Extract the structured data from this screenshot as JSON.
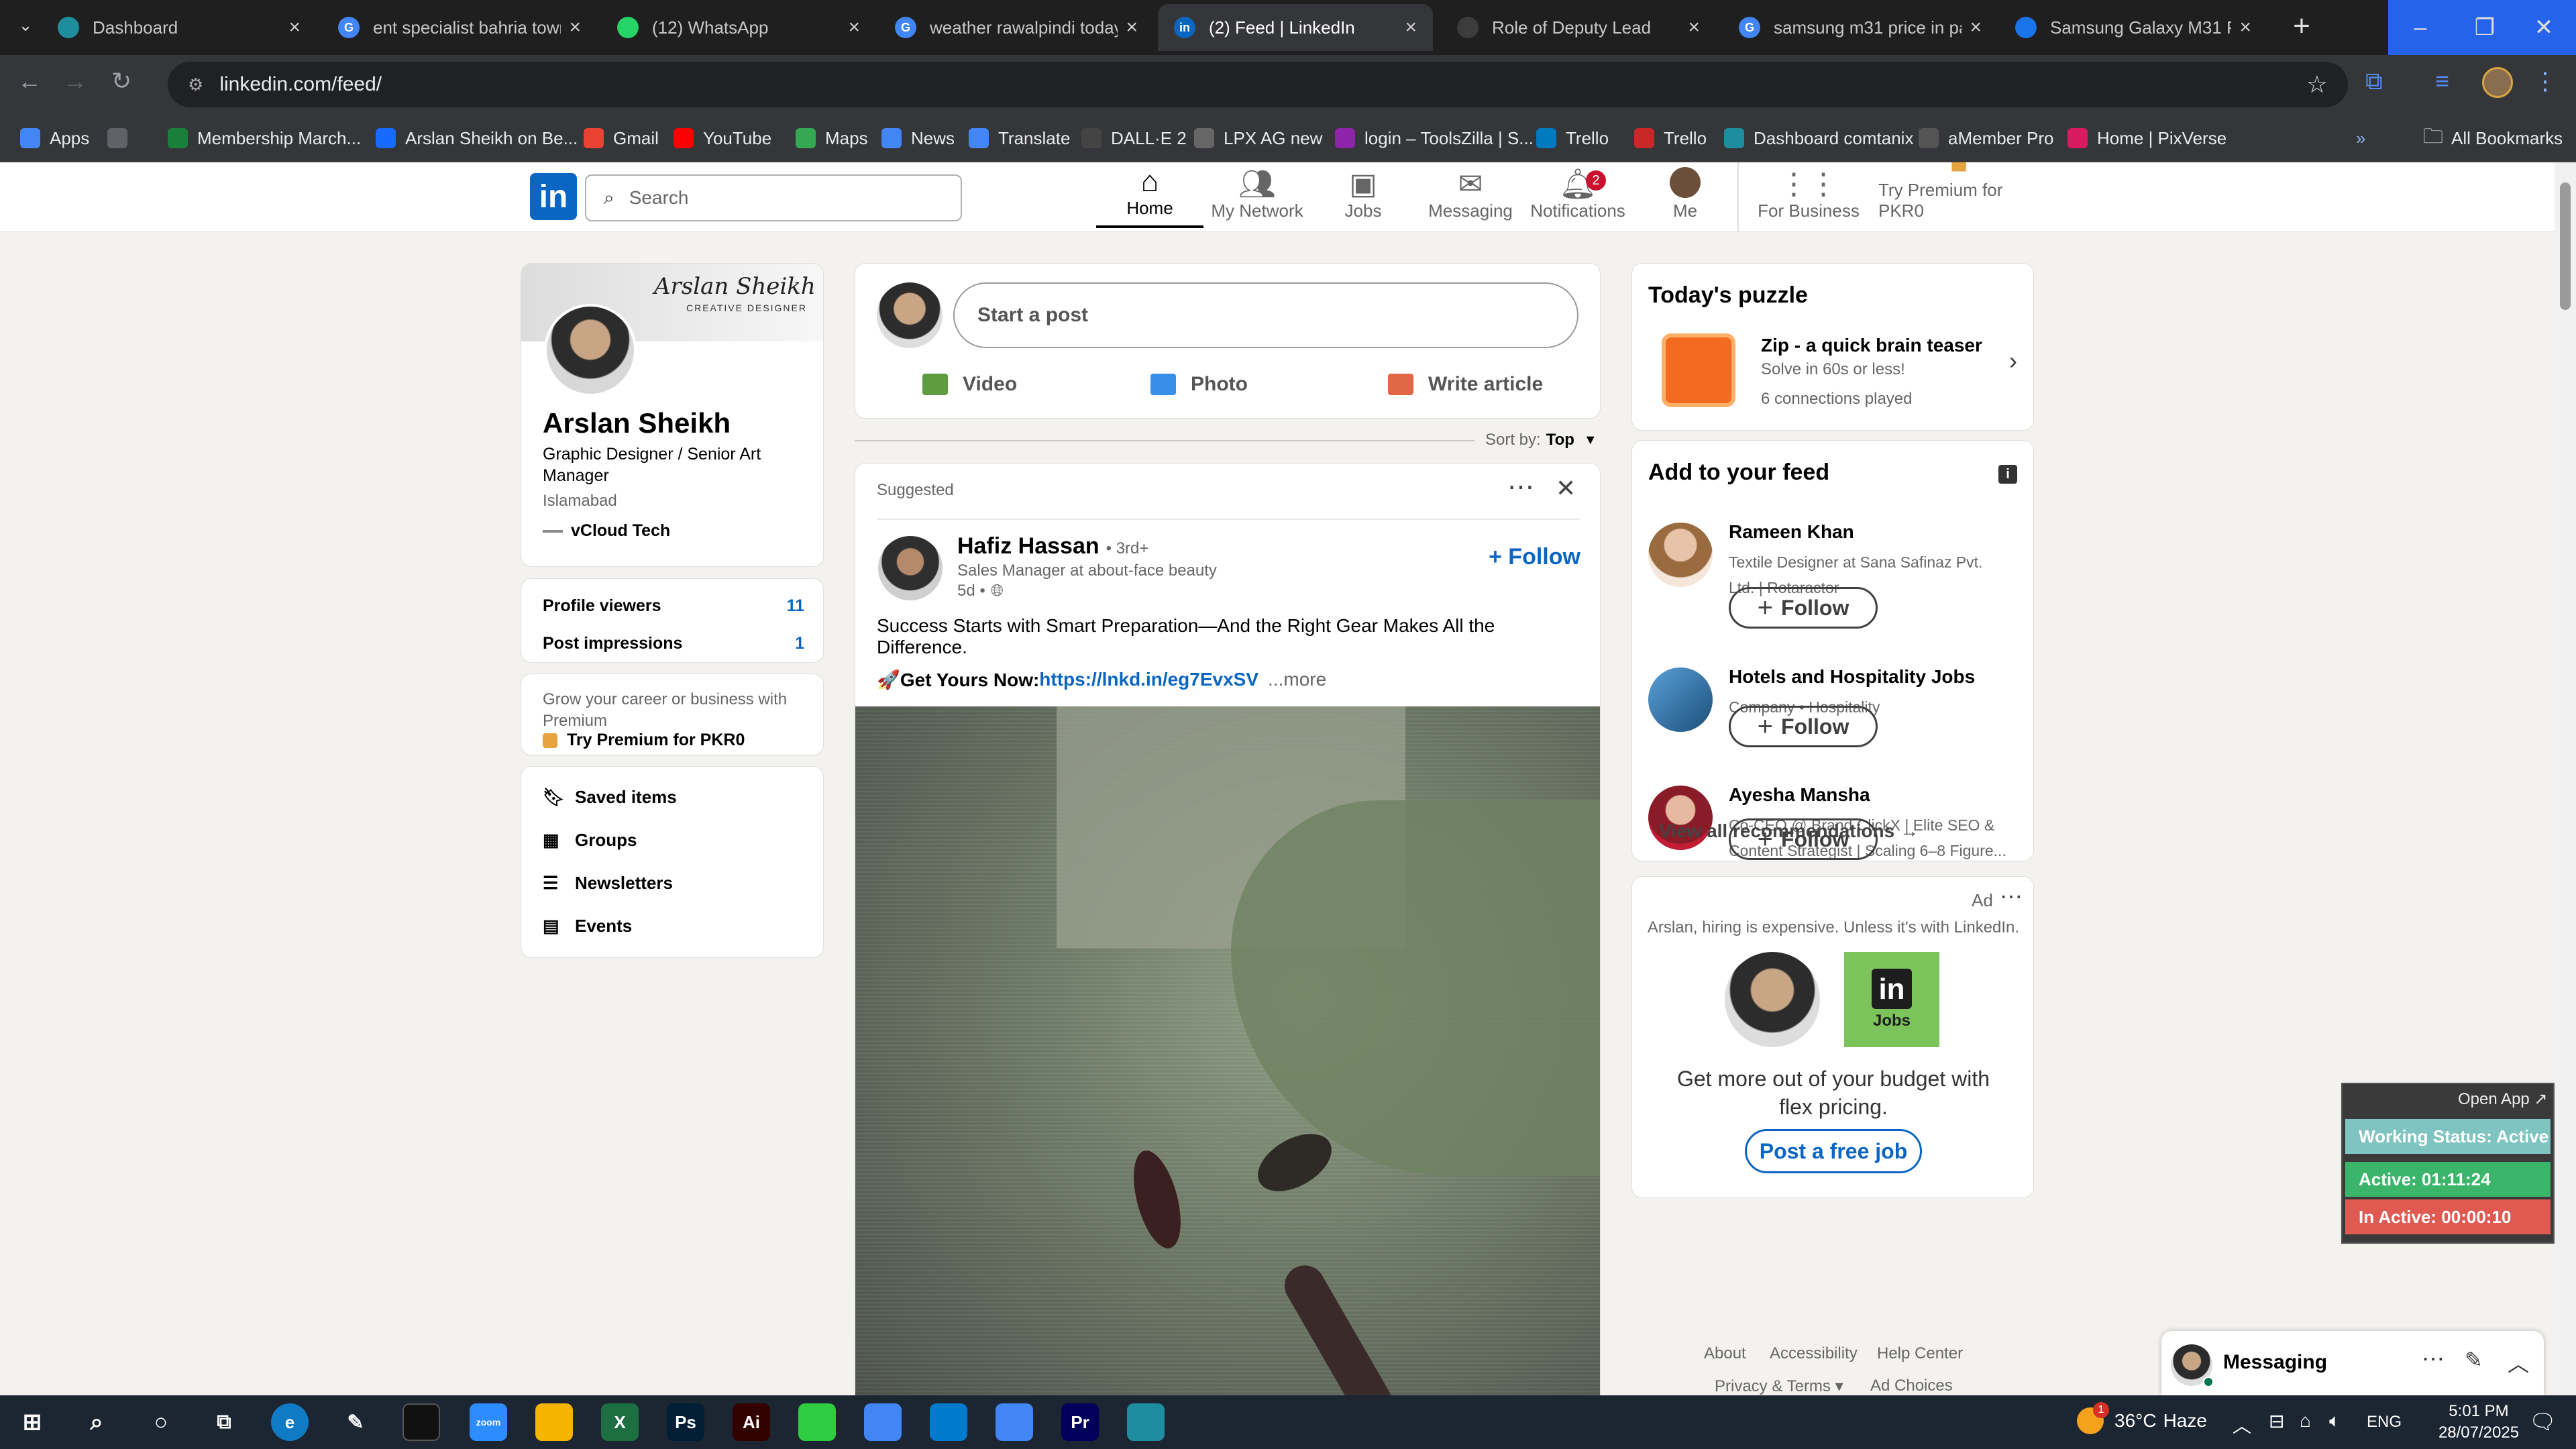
{
  "browser": {
    "tabs": [
      {
        "title": "Dashboard",
        "icon": "tab-favicon-icon",
        "color": "#1e8e9e"
      },
      {
        "title": "ent specialist bahria town",
        "icon": "google-icon",
        "color": "#4285f4"
      },
      {
        "title": "(12) WhatsApp",
        "icon": "whatsapp-icon",
        "color": "#25d366"
      },
      {
        "title": "weather rawalpindi today",
        "icon": "google-icon",
        "color": "#4285f4"
      },
      {
        "title": "(2) Feed | LinkedIn",
        "icon": "linkedin-icon",
        "color": "#0a66c2"
      },
      {
        "title": "Role of Deputy Lead",
        "icon": "tab-favicon-icon",
        "color": "#3c3c3c"
      },
      {
        "title": "samsung m31 price in pa",
        "icon": "google-icon",
        "color": "#4285f4"
      },
      {
        "title": "Samsung Galaxy M31 Pric",
        "icon": "tab-favicon-icon",
        "color": "#1a73e8"
      }
    ],
    "url": "linkedin.com/feed/",
    "bookmarks": [
      {
        "label": "Apps",
        "color": "#4285f4"
      },
      {
        "label": "",
        "color": "#5f6368"
      },
      {
        "label": "Membership March...",
        "color": "#188038"
      },
      {
        "label": "Arslan Sheikh on Be...",
        "color": "#1769ff"
      },
      {
        "label": "Gmail",
        "color": "#ea4335"
      },
      {
        "label": "YouTube",
        "color": "#ff0000"
      },
      {
        "label": "Maps",
        "color": "#34a853"
      },
      {
        "label": "News",
        "color": "#4285f4"
      },
      {
        "label": "Translate",
        "color": "#4285f4"
      },
      {
        "label": "DALL·E 2",
        "color": "#444444"
      },
      {
        "label": "LPX AG new",
        "color": "#666666"
      },
      {
        "label": "login – ToolsZilla | S...",
        "color": "#8e24aa"
      },
      {
        "label": "Trello",
        "color": "#0079bf"
      },
      {
        "label": "Trello",
        "color": "#c62828"
      },
      {
        "label": "Dashboard comtanix",
        "color": "#1e8e9e"
      },
      {
        "label": "aMember Pro",
        "color": "#555555"
      },
      {
        "label": "Home | PixVerse",
        "color": "#d81b60"
      }
    ],
    "all_bookmarks": "All Bookmarks"
  },
  "linkedin": {
    "search_placeholder": "Search",
    "nav": [
      {
        "label": "Home",
        "icon": "home-icon"
      },
      {
        "label": "My Network",
        "icon": "network-icon"
      },
      {
        "label": "Jobs",
        "icon": "briefcase-icon"
      },
      {
        "label": "Messaging",
        "icon": "messaging-icon"
      },
      {
        "label": "Notifications",
        "icon": "bell-icon",
        "badge": "2"
      },
      {
        "label": "Me",
        "icon": "avatar-icon"
      },
      {
        "label": "For Business",
        "icon": "grid-icon"
      },
      {
        "label": "Try Premium for PKR0",
        "icon": "premium-icon"
      }
    ],
    "profile": {
      "banner_name": "Arslan Sheikh",
      "banner_sub": "CREATIVE DESIGNER",
      "name": "Arslan Sheikh",
      "headline": "Graphic Designer / Senior Art Manager",
      "location": "Islamabad",
      "company": "vCloud Tech",
      "stats": [
        {
          "label": "Profile viewers",
          "value": "11"
        },
        {
          "label": "Post impressions",
          "value": "1"
        }
      ],
      "premium_text": "Grow your career or business with Premium",
      "premium_link": "Try Premium for PKR0",
      "links": [
        {
          "label": "Saved items",
          "icon": "bookmark-icon"
        },
        {
          "label": "Groups",
          "icon": "groups-icon"
        },
        {
          "label": "Newsletters",
          "icon": "newsletter-icon"
        },
        {
          "label": "Events",
          "icon": "calendar-icon"
        }
      ]
    },
    "composer": {
      "placeholder": "Start a post",
      "actions": [
        {
          "label": "Video",
          "icon": "video-icon",
          "color": "#5f9b41"
        },
        {
          "label": "Photo",
          "icon": "photo-icon",
          "color": "#378fe9"
        },
        {
          "label": "Write article",
          "icon": "article-icon",
          "color": "#e06847"
        }
      ]
    },
    "sort": {
      "label": "Sort by:",
      "value": "Top"
    },
    "post": {
      "suggested": "Suggested",
      "author": "Hafiz Hassan",
      "degree": "• 3rd+",
      "title": "Sales Manager at about-face beauty",
      "time": "5d •",
      "follow": "+ Follow",
      "text": "Success Starts with Smart Preparation—And the Right Gear Makes All the Difference.",
      "cta_prefix": "🚀Get Yours Now:",
      "cta_link": "https://lnkd.in/eg7EvxSV",
      "more": "...more"
    },
    "puzzle": {
      "heading": "Today's puzzle",
      "title": "Zip - a quick brain teaser",
      "sub": "Solve in 60s or less!",
      "played": "6 connections played"
    },
    "feed": {
      "heading": "Add to your feed",
      "items": [
        {
          "name": "Rameen Khan",
          "desc": "Textile Designer at Sana Safinaz Pvt. Ltd. | Rotaractor",
          "follow": "Follow"
        },
        {
          "name": "Hotels and Hospitality Jobs",
          "desc": "Company • Hospitality",
          "follow": "Follow"
        },
        {
          "name": "Ayesha Mansha",
          "desc": "Co-CEO @ Brand ClickX | Elite SEO & Content Strategist | Scaling 6–8 Figure...",
          "follow": "Follow"
        }
      ],
      "view_all": "View all recommendations →"
    },
    "ad": {
      "label": "Ad",
      "tagline": "Arslan, hiring is expensive. Unless it's with LinkedIn.",
      "jobs_logo": "Jobs",
      "text": "Get more out of your budget with flex pricing.",
      "button": "Post a free job"
    },
    "footer": {
      "links": [
        "About",
        "Accessibility",
        "Help Center"
      ],
      "links2": [
        "Privacy & Terms ▾",
        "Ad Choices"
      ]
    },
    "messaging": "Messaging"
  },
  "tracker": {
    "open_app": "Open App ↗",
    "status": "Working Status: Active",
    "active": "Active: 01:11:24",
    "inactive": "In Active: 00:00:10"
  },
  "taskbar": {
    "weather_temp": "36°C",
    "weather_desc": "Haze",
    "weather_badge": "1",
    "lang": "ENG",
    "time": "5:01 PM",
    "date": "28/07/2025",
    "apps": [
      {
        "label": "zoom",
        "color": "#2d8cff"
      },
      {
        "label": "",
        "color": "#f4b400"
      },
      {
        "label": "X",
        "color": "#1d6f42"
      },
      {
        "label": "Ps",
        "color": "#001e36"
      },
      {
        "label": "Ai",
        "color": "#330000"
      },
      {
        "label": "",
        "color": "#2ecc40"
      },
      {
        "label": "",
        "color": "#4285f4"
      },
      {
        "label": "",
        "color": "#007acc"
      },
      {
        "label": "",
        "color": "#4285f4"
      },
      {
        "label": "Pr",
        "color": "#00005b"
      },
      {
        "label": "",
        "color": "#1e8e9e"
      }
    ]
  }
}
